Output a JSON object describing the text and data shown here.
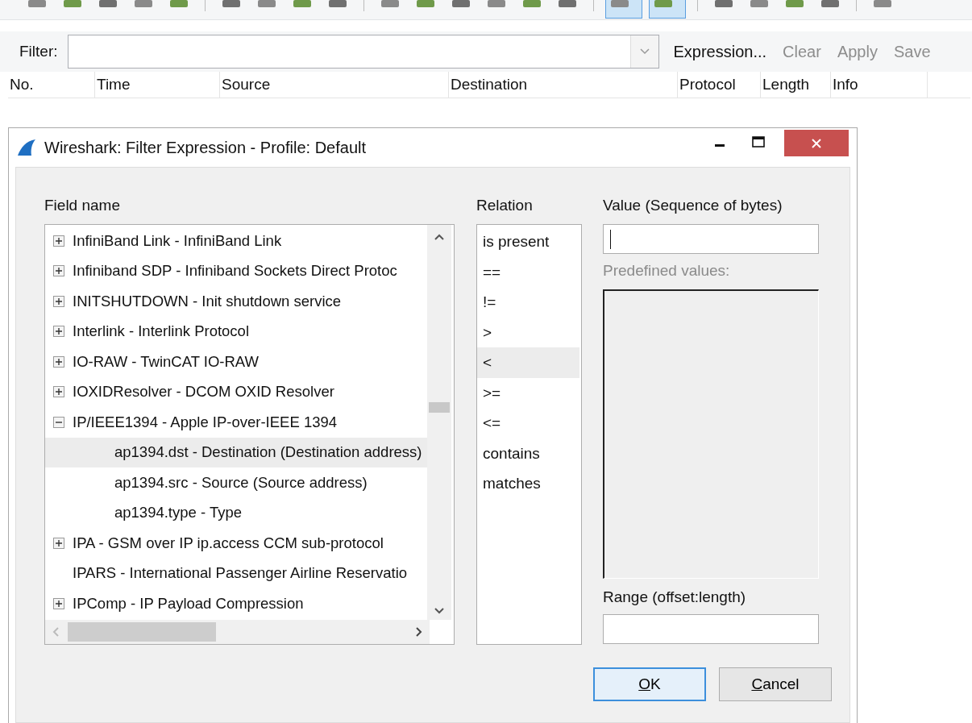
{
  "toolbar": {
    "buttons": [
      {
        "pressed": false
      },
      {
        "pressed": false
      },
      {
        "pressed": false
      },
      {
        "pressed": false
      },
      {
        "pressed": false
      },
      {
        "pressed": false
      },
      {
        "pressed": false
      },
      {
        "pressed": false
      },
      {
        "pressed": false
      },
      {
        "pressed": false
      },
      {
        "pressed": false
      },
      {
        "pressed": false
      },
      {
        "pressed": false
      },
      {
        "pressed": false
      },
      {
        "pressed": false
      },
      {
        "pressed": true
      },
      {
        "pressed": true
      },
      {
        "pressed": false
      },
      {
        "pressed": false
      },
      {
        "pressed": false
      },
      {
        "pressed": false
      },
      {
        "pressed": false
      }
    ]
  },
  "filter_bar": {
    "label": "Filter:",
    "buttons": [
      {
        "label": "Expression...",
        "disabled": false
      },
      {
        "label": "Clear",
        "disabled": true
      },
      {
        "label": "Apply",
        "disabled": true
      },
      {
        "label": "Save",
        "disabled": true
      }
    ]
  },
  "packet_list": {
    "columns": [
      "No.",
      "Time",
      "Source",
      "Destination",
      "Protocol",
      "Length",
      "Info"
    ]
  },
  "dialog": {
    "title": "Wireshark: Filter Expression - Profile: Default",
    "field_name": {
      "label": "Field name",
      "items": [
        {
          "label": "InfiniBand Link - InfiniBand Link",
          "expanded": false,
          "selected": false
        },
        {
          "label": "Infiniband SDP - Infiniband Sockets Direct Protoc",
          "expanded": false,
          "selected": false
        },
        {
          "label": "INITSHUTDOWN - Init shutdown service",
          "expanded": false,
          "selected": false
        },
        {
          "label": "Interlink - Interlink Protocol",
          "expanded": false,
          "selected": false
        },
        {
          "label": "IO-RAW - TwinCAT IO-RAW",
          "expanded": false,
          "selected": false
        },
        {
          "label": "IOXIDResolver - DCOM OXID Resolver",
          "expanded": false,
          "selected": false
        },
        {
          "label": "IP/IEEE1394 - Apple IP-over-IEEE 1394",
          "expanded": true,
          "selected": false,
          "children": [
            {
              "label": "ap1394.dst - Destination (Destination address)",
              "selected": true
            },
            {
              "label": "ap1394.src - Source (Source address)",
              "selected": false
            },
            {
              "label": "ap1394.type - Type",
              "selected": false
            }
          ]
        },
        {
          "label": "IPA - GSM over IP ip.access CCM sub-protocol",
          "expanded": false,
          "selected": false
        },
        {
          "label": "IPARS - International Passenger Airline Reservatio",
          "selected": false
        },
        {
          "label": "IPComp - IP Payload Compression",
          "expanded": false,
          "selected": false
        }
      ]
    },
    "relation": {
      "label": "Relation",
      "items": [
        {
          "label": "is present",
          "selected": false
        },
        {
          "label": "==",
          "selected": false
        },
        {
          "label": "!=",
          "selected": false
        },
        {
          "label": ">",
          "selected": false
        },
        {
          "label": "<",
          "selected": true
        },
        {
          "label": ">=",
          "selected": false
        },
        {
          "label": "<=",
          "selected": false
        },
        {
          "label": "contains",
          "selected": false
        },
        {
          "label": "matches",
          "selected": false
        }
      ]
    },
    "value": {
      "label": "Value (Sequence of bytes)",
      "predefined_label": "Predefined values:",
      "predefined_disabled": true,
      "range_label": "Range (offset:length)"
    },
    "buttons": [
      {
        "label": "OK",
        "default": true
      },
      {
        "label": "Cancel",
        "default": false
      }
    ]
  }
}
